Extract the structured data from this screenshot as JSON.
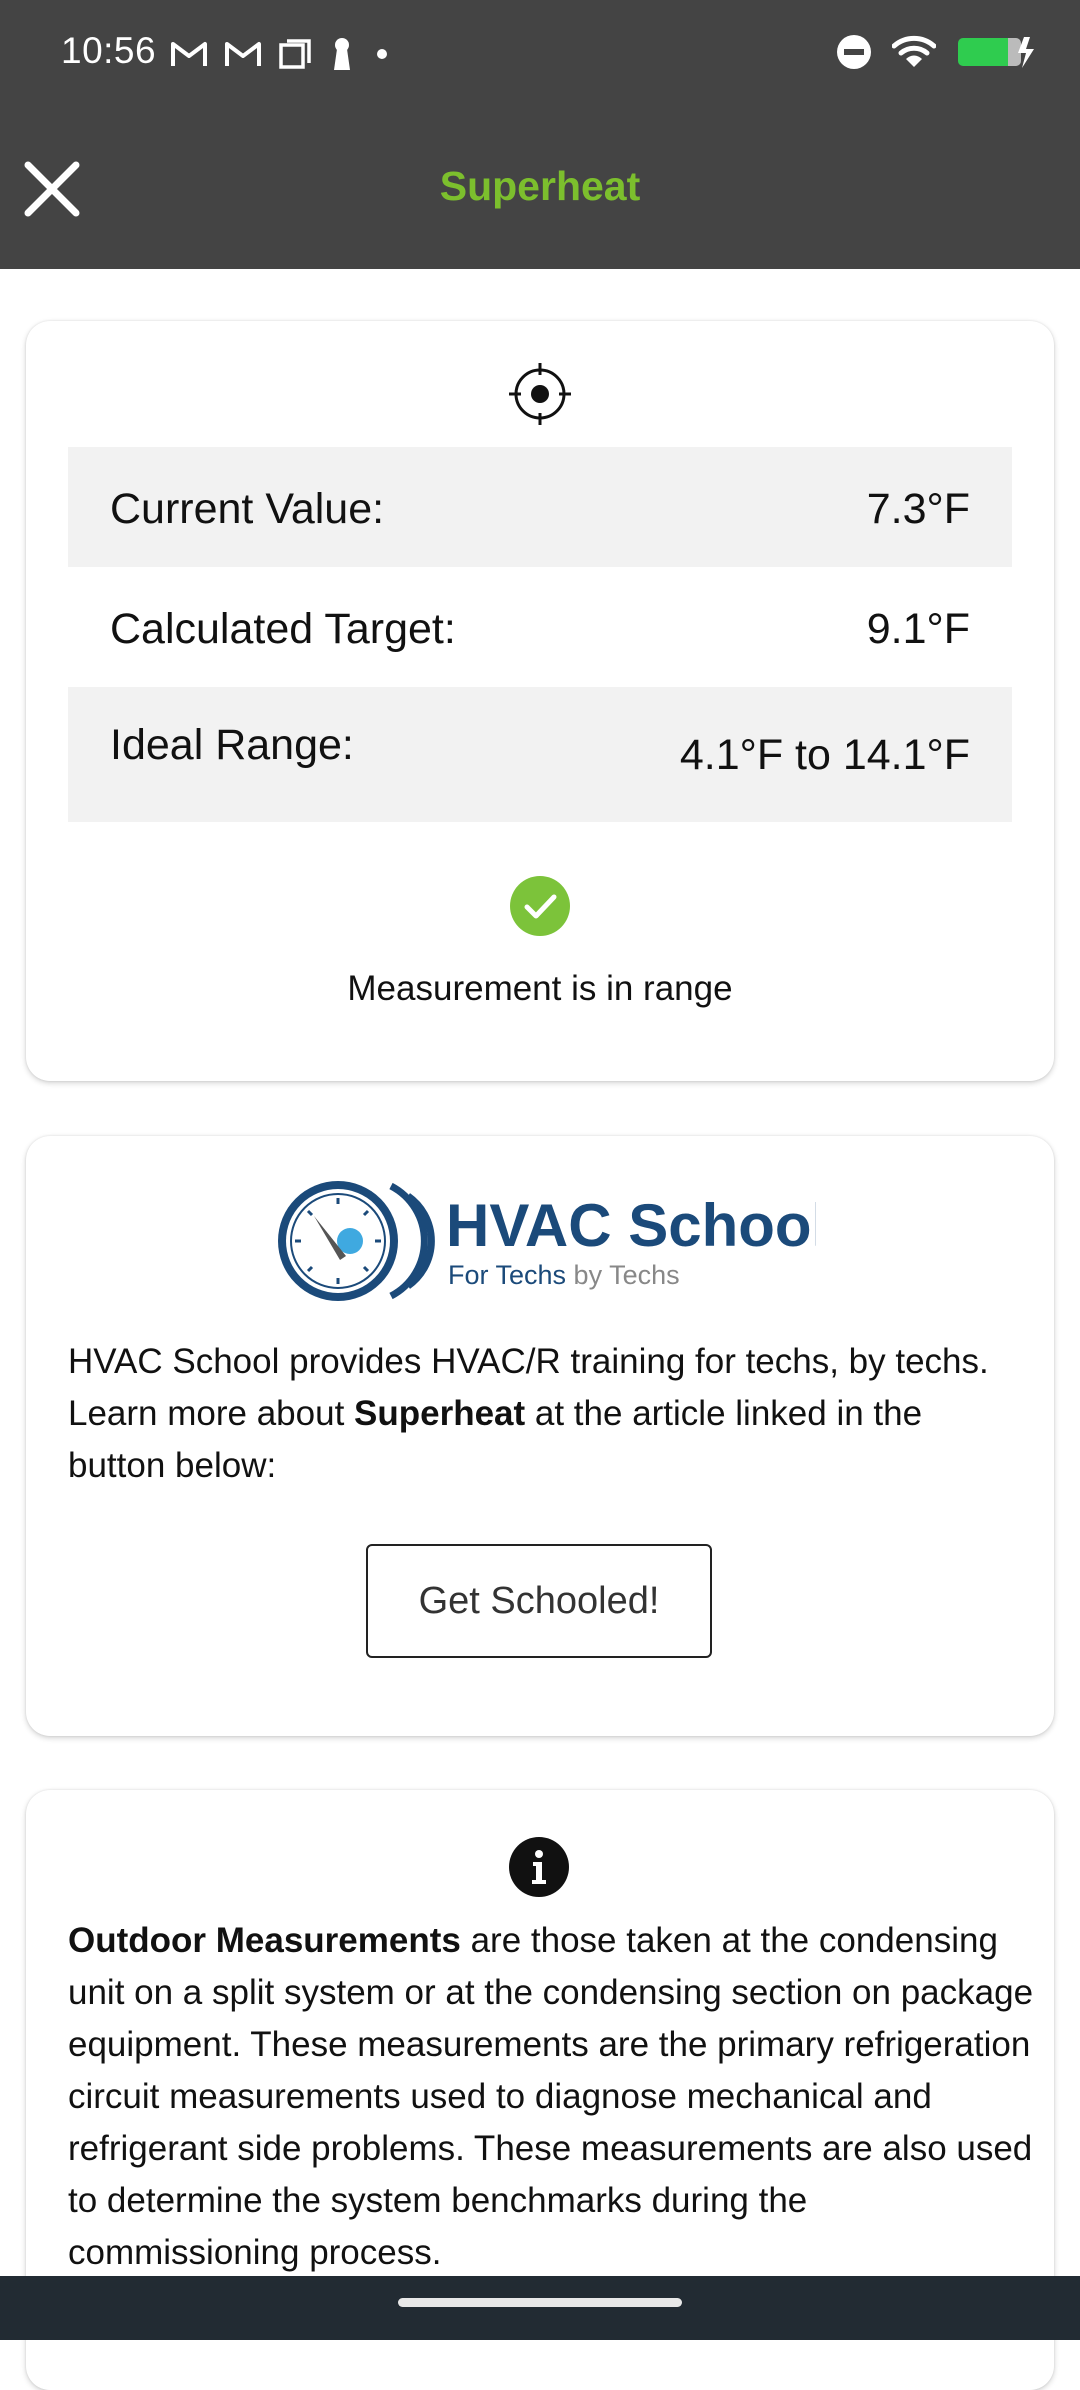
{
  "status_bar": {
    "time": "10:56",
    "icons_left": [
      "gmail-icon",
      "gmail-icon",
      "screenshot-icon",
      "keyhole-icon",
      "dot-icon"
    ],
    "icons_right": [
      "do-not-disturb-icon",
      "wifi-icon",
      "battery-charging-icon"
    ]
  },
  "app_bar": {
    "title": "Superheat",
    "close_icon": "close-icon",
    "title_color": "#7cbf2d",
    "background": "#444444"
  },
  "measurement_card": {
    "icon": "target-icon",
    "rows": [
      {
        "label": "Current Value:",
        "value": "7.3°F"
      },
      {
        "label": "Calculated Target:",
        "value": "9.1°F"
      },
      {
        "label": "Ideal Range:",
        "value": "4.1°F to 14.1°F"
      }
    ],
    "status_icon": "check-circle-icon",
    "status_color": "#7cc33a",
    "status_text": "Measurement is in range"
  },
  "school_card": {
    "logo_title": "HVAC School",
    "logo_subtitle_part1": "For Techs",
    "logo_subtitle_part2": " by Techs",
    "text_before": "HVAC School provides HVAC/R training for techs, by techs. Learn more about ",
    "text_bold": "Superheat",
    "text_after": " at the article linked in the button below:",
    "button_label": "Get Schooled!"
  },
  "info_card": {
    "icon": "info-icon",
    "text_bold": "Outdoor Measurements",
    "text_rest": " are those taken at the condensing unit on a split system or at the condensing section on package equipment. These measurements are the primary refrigeration circuit measurements used to diagnose mechanical and refrigerant side problems. These measurements are also used to determine the system benchmarks during the commissioning process."
  }
}
